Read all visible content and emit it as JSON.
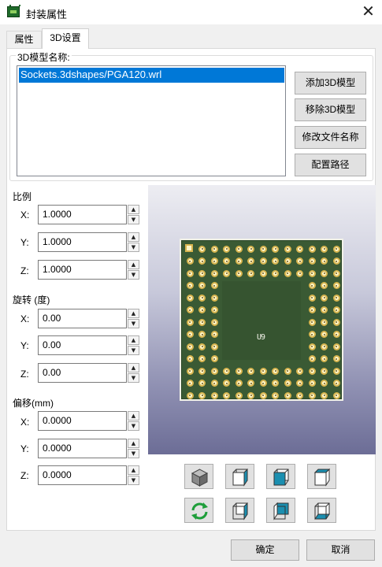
{
  "window": {
    "title": "封装属性",
    "close_glyph": "✕"
  },
  "tabs": [
    {
      "label": "属性",
      "selected": false
    },
    {
      "label": "3D设置",
      "selected": true
    }
  ],
  "models": {
    "group_label": "3D模型名称:",
    "items": [
      "Sockets.3dshapes/PGA120.wrl"
    ],
    "selected_item": "Sockets.3dshapes/PGA120.wrl",
    "buttons": {
      "add": "添加3D模型",
      "remove": "移除3D模型",
      "rename": "修改文件名称",
      "paths": "配置路径"
    }
  },
  "scale": {
    "label": "比例",
    "x_label": "X:",
    "y_label": "Y:",
    "z_label": "Z:",
    "x": "1.0000",
    "y": "1.0000",
    "z": "1.0000"
  },
  "rotation": {
    "label": "旋转 (度)",
    "x_label": "X:",
    "y_label": "Y:",
    "z_label": "Z:",
    "x": "0.00",
    "y": "0.00",
    "z": "0.00"
  },
  "offset": {
    "label": "偏移(mm)",
    "x_label": "X:",
    "y_label": "Y:",
    "z_label": "Z:",
    "x": "0.0000",
    "y": "0.0000",
    "z": "0.0000"
  },
  "preview": {
    "reference": "U9",
    "pin_grid": "13x13, 3 outer rings",
    "board_color": "#3a5a34"
  },
  "view_buttons": [
    "iso-cube-icon",
    "view-front-icon",
    "view-left-icon",
    "view-top-icon",
    "reload-icon",
    "view-back-icon",
    "view-right-icon",
    "view-bottom-icon"
  ],
  "spin": {
    "up_glyph": "▲",
    "down_glyph": "▼"
  },
  "dialog_buttons": {
    "ok": "确定",
    "cancel": "取消"
  },
  "colors": {
    "selection": "#0078d7",
    "button_face": "#e1e1e1",
    "cube_teal": "#1b8fb0"
  }
}
